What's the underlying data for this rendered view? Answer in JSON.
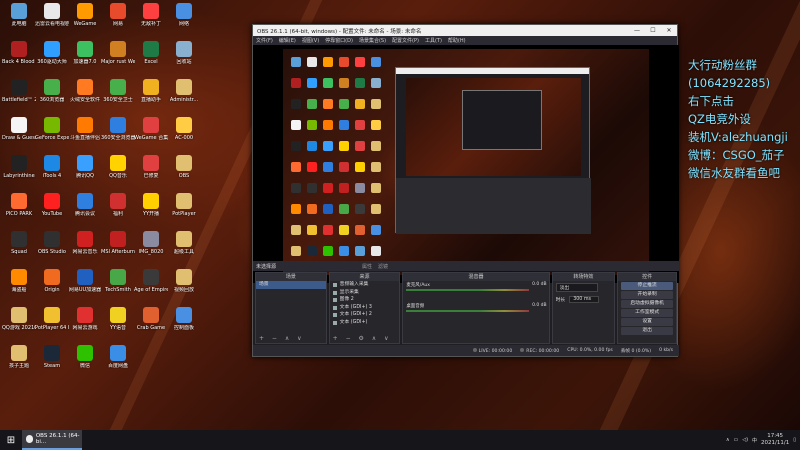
{
  "desktop_icons": [
    {
      "label": "此电脑",
      "color": "#5aa0d8"
    },
    {
      "label": "迅雷云看电视剧",
      "color": "#e8e8e8"
    },
    {
      "label": "WeGame",
      "color": "#ff9a00"
    },
    {
      "label": "网易",
      "color": "#e84a2c"
    },
    {
      "label": "无敌补丁",
      "color": "#ff4040"
    },
    {
      "label": "网络",
      "color": "#4a90e2"
    },
    {
      "label": "Back 4 Blood Beta",
      "color": "#b02020"
    },
    {
      "label": "360驱动大师",
      "color": "#2fa0ff"
    },
    {
      "label": "加速器7.0",
      "color": "#3cc060"
    },
    {
      "label": "Major rust WeGame版",
      "color": "#d08020"
    },
    {
      "label": "Excel",
      "color": "#1e7b45"
    },
    {
      "label": "回收站",
      "color": "#8ab0d0"
    },
    {
      "label": "Battlefield™ 2042 Open",
      "color": "#222"
    },
    {
      "label": "360浏览器",
      "color": "#48b04a"
    },
    {
      "label": "火绒安全软件",
      "color": "#ff7a20"
    },
    {
      "label": "360安全卫士",
      "color": "#48b04a"
    },
    {
      "label": "直播助手",
      "color": "#f0b020"
    },
    {
      "label": "Administr...",
      "color": "#e0c070"
    },
    {
      "label": "Draw & Guess",
      "color": "#f5f5f5"
    },
    {
      "label": "GeForce Experience",
      "color": "#76b900"
    },
    {
      "label": "斗鱼直播伴侣",
      "color": "#ff7a00"
    },
    {
      "label": "360安全浏览器",
      "color": "#2f7fe0"
    },
    {
      "label": "WeGame 合集",
      "color": "#e04040"
    },
    {
      "label": "AC-000",
      "color": "#ffcc44"
    },
    {
      "label": "Labyrinthine",
      "color": "#222"
    },
    {
      "label": "iTools 4",
      "color": "#1e88e5"
    },
    {
      "label": "腾讯QQ",
      "color": "#3aa0ff"
    },
    {
      "label": "QQ音乐",
      "color": "#ffd200"
    },
    {
      "label": "已修复",
      "color": "#e04040"
    },
    {
      "label": "OBS",
      "color": "#e0c070"
    },
    {
      "label": "PICO PARK",
      "color": "#ff6a30"
    },
    {
      "label": "YouTube",
      "color": "#ff2020"
    },
    {
      "label": "腾讯会议",
      "color": "#2f7fe0"
    },
    {
      "label": "福利",
      "color": "#d03030"
    },
    {
      "label": "YY开播",
      "color": "#ffd000"
    },
    {
      "label": "PotPlayer",
      "color": "#e0c070"
    },
    {
      "label": "Squad",
      "color": "#303030"
    },
    {
      "label": "OBS Studio",
      "color": "#303030"
    },
    {
      "label": "网易云音乐",
      "color": "#d02020"
    },
    {
      "label": "MSI Afterburner",
      "color": "#c02020"
    },
    {
      "label": "IMG_8020",
      "color": "#8a8aa0"
    },
    {
      "label": "超级工具",
      "color": "#e0c070"
    },
    {
      "label": "海盗船",
      "color": "#ff8a00"
    },
    {
      "label": "Origin",
      "color": "#f06a20"
    },
    {
      "label": "网易UU加速器",
      "color": "#2060c0"
    },
    {
      "label": "TechSmith",
      "color": "#48a848"
    },
    {
      "label": "Age of Empires IV",
      "color": "#3a3a3a"
    },
    {
      "label": "视频回放",
      "color": "#e0c070"
    },
    {
      "label": "QQ游戏 20210415...",
      "color": "#e0c070"
    },
    {
      "label": "PotPlayer 64 bit",
      "color": "#f0c030"
    },
    {
      "label": "网易云游戏",
      "color": "#e03030"
    },
    {
      "label": "YY语音",
      "color": "#f0d020"
    },
    {
      "label": "Crab Game",
      "color": "#e06030"
    },
    {
      "label": "控制面板",
      "color": "#4a90e2"
    },
    {
      "label": "孩子主题",
      "color": "#e0c070"
    },
    {
      "label": "Steam",
      "color": "#1b2838"
    },
    {
      "label": "微信",
      "color": "#2dc100"
    },
    {
      "label": "百度网盘",
      "color": "#3a8ee6"
    }
  ],
  "overlay_text": [
    "大行动粉丝群",
    "(1064292285)",
    "右下点击",
    "QZ电竞外设",
    "装机V:alezhuangji",
    "微博：CSGO_茄子",
    "微信水友群看鱼吧"
  ],
  "obs": {
    "title": "OBS 26.1.1 (64-bit, windows) - 配置文件: 未命名 - 场景: 未命名",
    "menu": [
      "文件(F)",
      "编辑(E)",
      "视图(V)",
      "停靠窗口(D)",
      "场景集合(S)",
      "配置文件(P)",
      "工具(T)",
      "帮助(H)"
    ],
    "scene_bar": {
      "label": "未选择源",
      "properties": "属性",
      "filters": "滤镜"
    },
    "docks": {
      "scenes": {
        "title": "场景",
        "items": [
          "场景"
        ]
      },
      "sources": {
        "title": "来源",
        "items": [
          "音频输入采集",
          "显示采集",
          "图像 2",
          "文本 (GDI+) 3",
          "文本 (GDI+) 2",
          "文本 (GDI+)"
        ]
      },
      "mixer": {
        "title": "混音器",
        "channels": [
          {
            "name": "麦克风/Aux",
            "db": "0.0 dB"
          },
          {
            "name": "桌面音频",
            "db": "0.0 dB"
          }
        ]
      },
      "transitions": {
        "title": "转场特效",
        "type": "淡出",
        "duration_label": "时长",
        "duration": "300 ms"
      },
      "controls": {
        "title": "控件",
        "buttons": [
          "停止推流",
          "开始录制",
          "启动虚拟摄像机",
          "工作室模式",
          "设置",
          "退出"
        ]
      }
    },
    "status": {
      "live": "LIVE: 00:00:00",
      "rec": "REC: 00:00:00",
      "cpu": "CPU: 0.0%, 0.00 fps",
      "dropped": "丢帧 0 (0.0%)",
      "kbps": "0 kb/s"
    }
  },
  "taskbar": {
    "task_label": "OBS 26.1.1 (64-bi...",
    "time": "17:45",
    "date": "2021/11/1"
  }
}
